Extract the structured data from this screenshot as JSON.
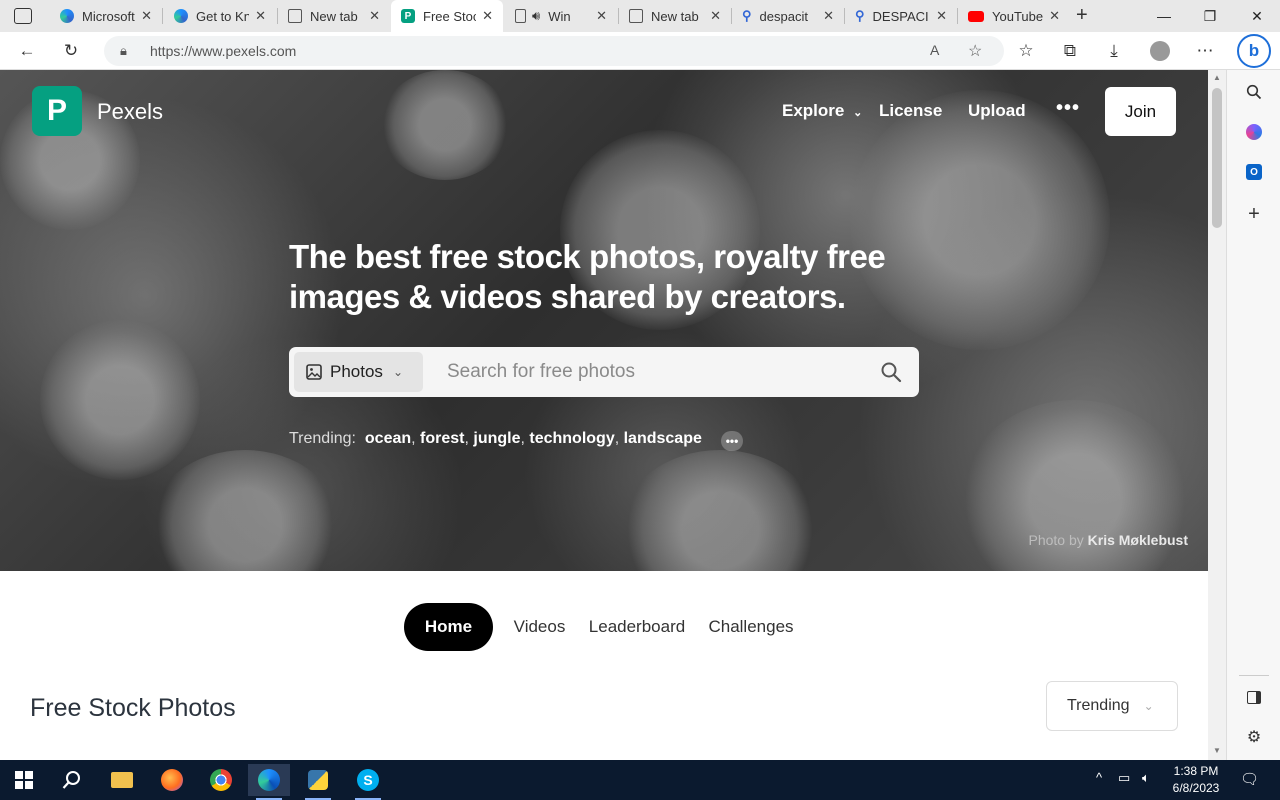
{
  "browser": {
    "tabs": [
      {
        "label": "Microsoft",
        "favicon": "edge-icon",
        "active": false
      },
      {
        "label": "Get to Kn",
        "favicon": "edge-icon",
        "active": false
      },
      {
        "label": "New tab",
        "favicon": "newtab-icon",
        "active": false
      },
      {
        "label": "Free Stoc",
        "favicon": "pexels-icon",
        "active": true
      },
      {
        "label": "Win",
        "favicon": "audio-icon",
        "active": false
      },
      {
        "label": "New tab",
        "favicon": "newtab-icon",
        "active": false
      },
      {
        "label": "despacit",
        "favicon": "search-icon",
        "active": false
      },
      {
        "label": "DESPACI",
        "favicon": "search-icon",
        "active": false
      },
      {
        "label": "YouTube",
        "favicon": "youtube-icon",
        "active": false
      }
    ],
    "url": "https://www.pexels.com"
  },
  "site": {
    "logo_letter": "P",
    "logo_text": "Pexels",
    "nav": {
      "explore": "Explore",
      "license": "License",
      "upload": "Upload",
      "join": "Join"
    },
    "headline": "The best free stock photos, royalty free images & videos shared by creators.",
    "search": {
      "type_label": "Photos",
      "placeholder": "Search for free photos"
    },
    "trending": {
      "label": "Trending:",
      "terms": [
        "ocean",
        "forest",
        "jungle",
        "technology",
        "landscape"
      ]
    },
    "credit": {
      "prefix": "Photo by",
      "author": "Kris Møklebust"
    },
    "subnav": [
      "Home",
      "Videos",
      "Leaderboard",
      "Challenges"
    ],
    "section_title": "Free Stock Photos",
    "sort_label": "Trending"
  },
  "taskbar": {
    "time": "1:38 PM",
    "date": "6/8/2023"
  },
  "colors": {
    "brand": "#05a081",
    "taskbar": "#0b1a2f"
  }
}
